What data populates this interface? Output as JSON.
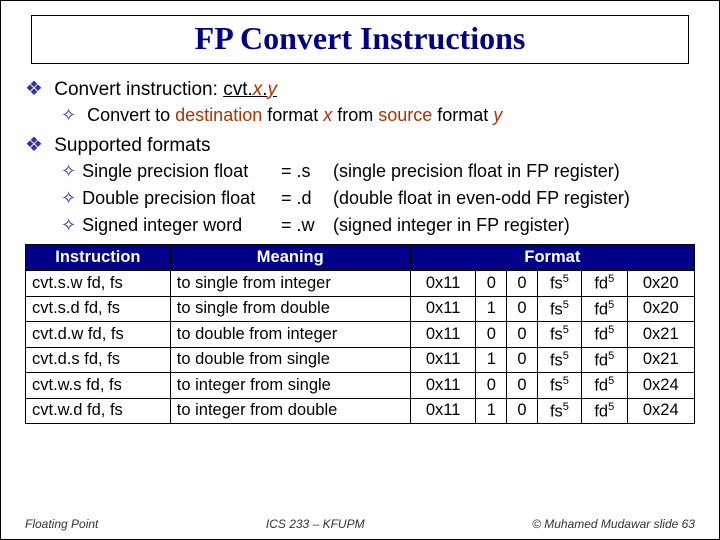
{
  "title": "FP Convert Instructions",
  "intro": {
    "label": "Convert instruction: ",
    "pattern": "cvt.",
    "x": "x",
    "dot": ".",
    "y": "y",
    "sub_prefix": "Convert to ",
    "sub_dest": "destination",
    "sub_mid1": " format ",
    "sub_x": "x",
    "sub_mid2": " from ",
    "sub_src": "source",
    "sub_mid3": " format ",
    "sub_y": "y"
  },
  "supported": {
    "label": "Supported formats",
    "rows": [
      {
        "name": "Single precision float",
        "eq": "= .s",
        "desc": "(single precision float in FP register)"
      },
      {
        "name": "Double precision float",
        "eq": "= .d",
        "desc": "(double float in even-odd FP register)"
      },
      {
        "name": "Signed integer word",
        "eq": "= .w",
        "desc": "(signed integer in FP register)"
      }
    ]
  },
  "table": {
    "headers": {
      "instr": "Instruction",
      "meaning": "Meaning",
      "format": "Format"
    },
    "rows": [
      {
        "mn": "cvt.s.w  fd, fs",
        "mean": "to single from integer",
        "op": "0x11",
        "f1": "0",
        "f2": "0",
        "fs": "fs",
        "fse": "5",
        "fd": "fd",
        "fde": "5",
        "func": "0x20"
      },
      {
        "mn": "cvt.s.d  fd, fs",
        "mean": "to single from double",
        "op": "0x11",
        "f1": "1",
        "f2": "0",
        "fs": "fs",
        "fse": "5",
        "fd": "fd",
        "fde": "5",
        "func": "0x20"
      },
      {
        "mn": "cvt.d.w  fd, fs",
        "mean": "to double from integer",
        "op": "0x11",
        "f1": "0",
        "f2": "0",
        "fs": "fs",
        "fse": "5",
        "fd": "fd",
        "fde": "5",
        "func": "0x21"
      },
      {
        "mn": "cvt.d.s  fd, fs",
        "mean": "to double from single",
        "op": "0x11",
        "f1": "1",
        "f2": "0",
        "fs": "fs",
        "fse": "5",
        "fd": "fd",
        "fde": "5",
        "func": "0x21"
      },
      {
        "mn": "cvt.w.s  fd, fs",
        "mean": "to integer from single",
        "op": "0x11",
        "f1": "0",
        "f2": "0",
        "fs": "fs",
        "fse": "5",
        "fd": "fd",
        "fde": "5",
        "func": "0x24"
      },
      {
        "mn": "cvt.w.d  fd, fs",
        "mean": "to integer from double",
        "op": "0x11",
        "f1": "1",
        "f2": "0",
        "fs": "fs",
        "fse": "5",
        "fd": "fd",
        "fde": "5",
        "func": "0x24"
      }
    ]
  },
  "footer": {
    "left": "Floating Point",
    "center": "ICS 233 – KFUPM",
    "right": "© Muhamed Mudawar   slide 63"
  }
}
